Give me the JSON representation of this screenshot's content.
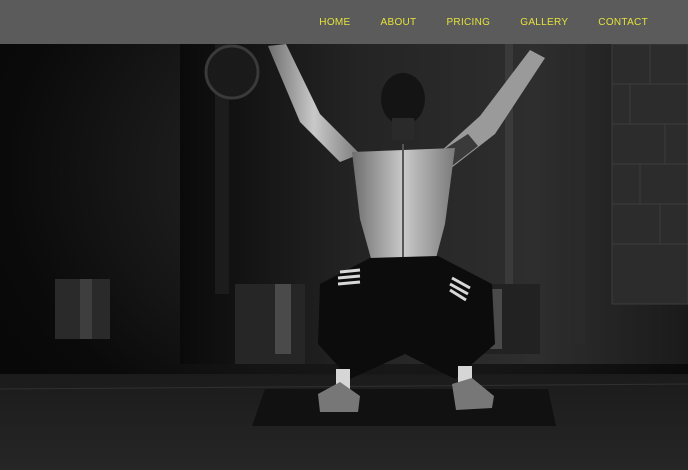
{
  "nav": {
    "items": [
      {
        "label": "HOME"
      },
      {
        "label": "ABOUT"
      },
      {
        "label": "PRICING"
      },
      {
        "label": "GALLERY"
      },
      {
        "label": "CONTACT"
      }
    ]
  },
  "colors": {
    "navbar_bg": "#5b5b5b",
    "nav_text": "#e4e23b",
    "hero_bg": "#0b0b0b"
  }
}
